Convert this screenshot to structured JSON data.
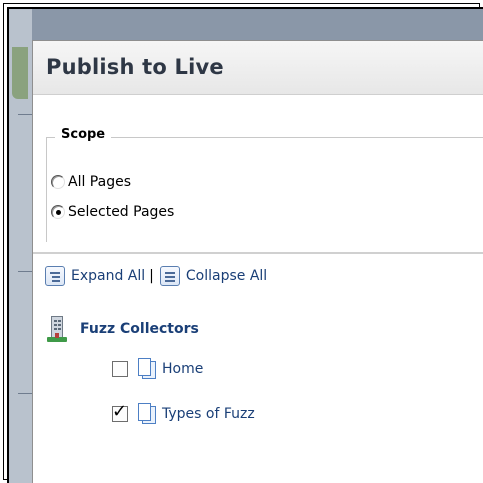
{
  "dialog": {
    "title": "Publish to Live"
  },
  "scope": {
    "legend": "Scope",
    "options": [
      {
        "label": "All Pages",
        "selected": false
      },
      {
        "label": "Selected Pages",
        "selected": true
      }
    ]
  },
  "toolbar": {
    "expand_all_label": "Expand All",
    "separator": "|",
    "collapse_all_label": "Collapse All",
    "expand_icon": "expand-all-icon",
    "collapse_icon": "collapse-all-icon"
  },
  "tree": {
    "root": {
      "label": "Fuzz Collectors",
      "icon": "site-building-icon"
    },
    "items": [
      {
        "label": "Home",
        "checked": false,
        "icon": "page-icon"
      },
      {
        "label": "Types of Fuzz",
        "checked": true,
        "icon": "page-icon"
      }
    ]
  },
  "colors": {
    "link": "#1a3f77",
    "title": "#2e3745"
  }
}
